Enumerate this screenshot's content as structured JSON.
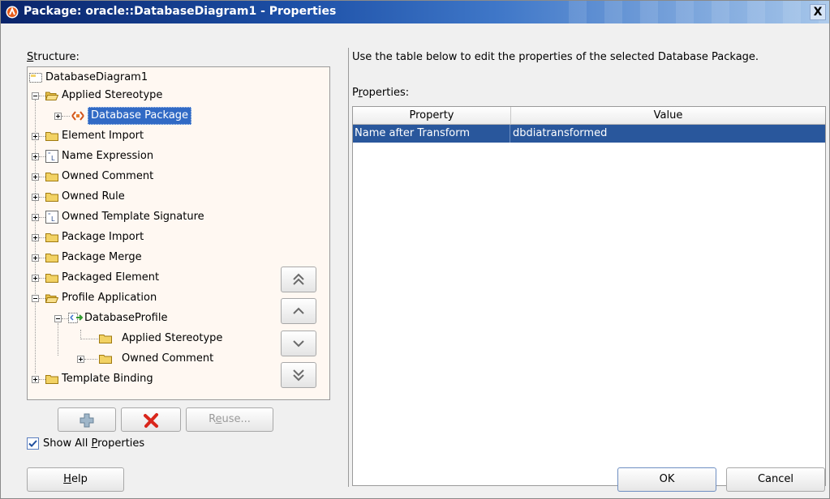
{
  "window": {
    "title": "Package: oracle::DatabaseDiagram1 - Properties",
    "close_glyph": "X"
  },
  "structure": {
    "label_prefix": "",
    "label_mnemonic": "S",
    "label_rest": "tructure:",
    "items": [
      {
        "label": "DatabaseDiagram1",
        "icon": "package-icon"
      },
      {
        "label": "Applied Stereotype",
        "icon": "folder-open-icon"
      },
      {
        "label": "Database Package",
        "icon": "stereotype-icon"
      },
      {
        "label": "Element Import",
        "icon": "folder-icon"
      },
      {
        "label": "Name Expression",
        "icon": "expression-icon"
      },
      {
        "label": "Owned Comment",
        "icon": "folder-icon"
      },
      {
        "label": "Owned Rule",
        "icon": "folder-icon"
      },
      {
        "label": "Owned Template Signature",
        "icon": "expression-icon"
      },
      {
        "label": "Package Import",
        "icon": "folder-icon"
      },
      {
        "label": "Package Merge",
        "icon": "folder-icon"
      },
      {
        "label": "Packaged Element",
        "icon": "folder-icon"
      },
      {
        "label": "Profile Application",
        "icon": "folder-open-icon"
      },
      {
        "label": "DatabaseProfile",
        "icon": "profile-icon"
      },
      {
        "label": "Applied Stereotype",
        "icon": "folder-icon"
      },
      {
        "label": "Owned Comment",
        "icon": "folder-icon"
      },
      {
        "label": "Template Binding",
        "icon": "folder-icon"
      }
    ]
  },
  "toolbar": {
    "add_icon": "add-icon",
    "remove_icon": "remove-icon",
    "reuse_prefix": "R",
    "reuse_mnemonic": "e",
    "reuse_rest": "use..."
  },
  "show_all": {
    "checked": true,
    "label_prefix": "Show All ",
    "label_mnemonic": "P",
    "label_rest": "roperties"
  },
  "description": "Use the table below to edit the properties of the selected Database Package.",
  "properties": {
    "label_prefix": "P",
    "label_mnemonic": "r",
    "label_rest": "operties:",
    "columns": [
      "Property",
      "Value"
    ],
    "rows": [
      {
        "property": "Name after Transform",
        "value": "dbdiatransformed"
      }
    ]
  },
  "move_buttons": [
    "move-to-top-icon",
    "move-up-icon",
    "move-down-icon",
    "move-to-bottom-icon"
  ],
  "buttons": {
    "help_mnemonic": "H",
    "help_rest": "elp",
    "ok": "OK",
    "cancel": "Cancel"
  }
}
